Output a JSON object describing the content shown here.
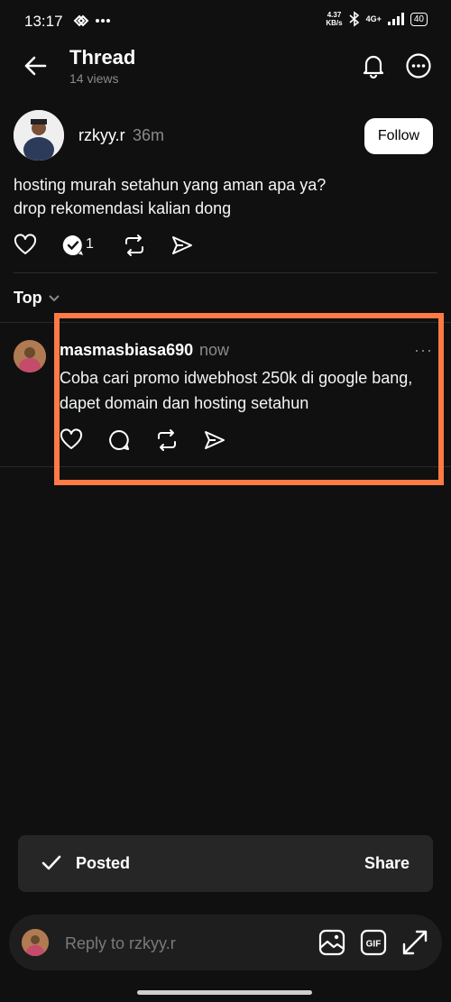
{
  "status_bar": {
    "time": "13:17",
    "net_speed_value": "4.37",
    "net_speed_unit": "KB/s",
    "network": "4G+",
    "battery": "40"
  },
  "header": {
    "title": "Thread",
    "views": "14 views",
    "icons": [
      "back-arrow-icon",
      "bell-icon",
      "more-options-icon"
    ]
  },
  "op": {
    "username": "rzkyy.r",
    "time": "36m",
    "follow_label": "Follow",
    "text_line1": "hosting murah setahun yang aman apa ya?",
    "text_line2": "drop rekomendasi kalian dong",
    "reply_count": "1"
  },
  "sort": {
    "label": "Top"
  },
  "reply": {
    "username": "masmasbiasa690",
    "time": "now",
    "more": "···",
    "text_line1": "Coba cari promo idwebhost 250k di google bang,",
    "text_line2": "dapet domain dan hosting setahun",
    "highlight_color": "#ff7a45"
  },
  "toast": {
    "label": "Posted",
    "share_label": "Share"
  },
  "composer": {
    "placeholder": "Reply to rzkyy.r"
  },
  "colors": {
    "background": "#101010",
    "text": "#f3f5f7",
    "muted": "#8a8a8a",
    "toast": "#262626"
  }
}
